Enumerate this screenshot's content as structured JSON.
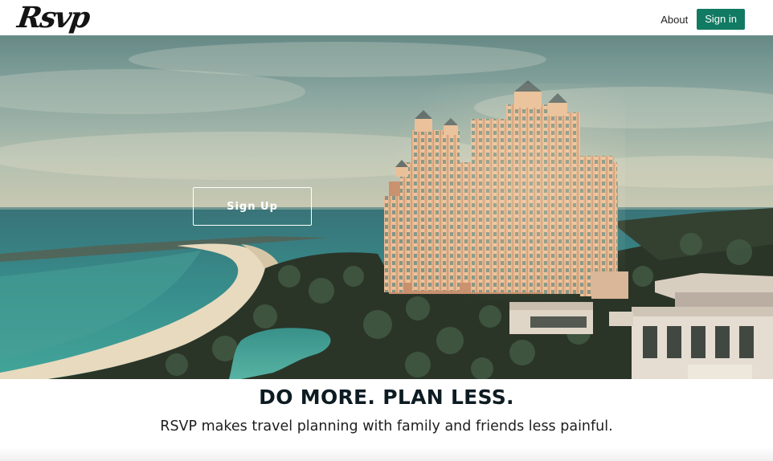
{
  "header": {
    "logo_text": "Rsvp",
    "nav": {
      "about_label": "About",
      "signin_label": "Sign in"
    }
  },
  "hero": {
    "cta_label": "Sign Up"
  },
  "tagline": {
    "headline": "DO MORE. PLAN LESS.",
    "subline": "RSVP makes travel planning with family and friends less painful."
  },
  "colors": {
    "accent": "#117a62",
    "headline": "#0d1b22"
  }
}
